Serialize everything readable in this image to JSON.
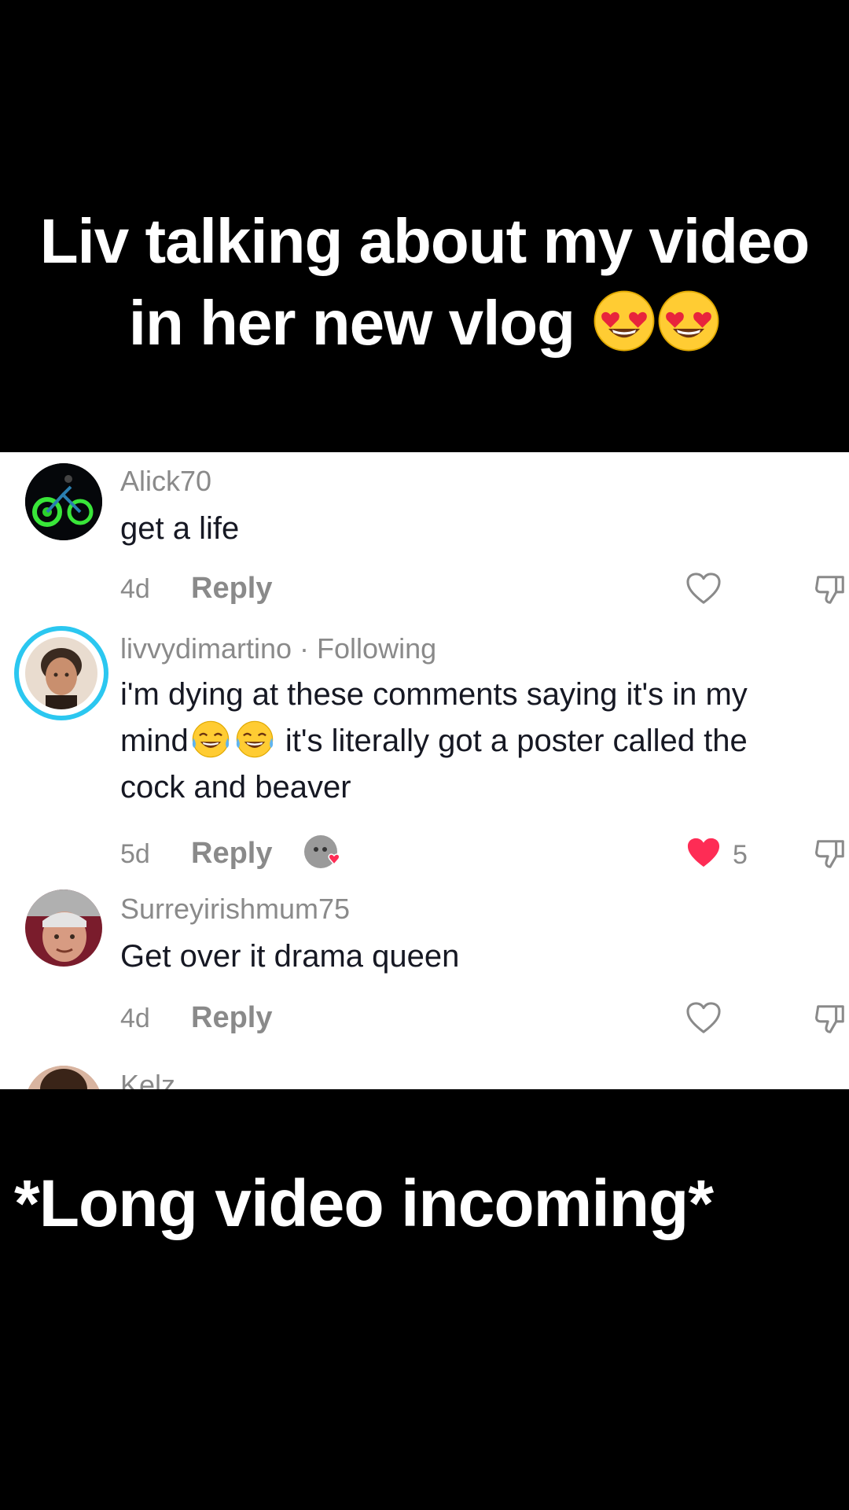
{
  "captions": {
    "top_line1": "Liv talking about my video",
    "top_line2": "in her new vlog",
    "bottom": "*Long video incoming*"
  },
  "comments": [
    {
      "username": "Alick70",
      "text": "get a life",
      "age": "4d",
      "reply_label": "Reply"
    },
    {
      "username": "livvydimartino · Following",
      "text_part1": "i'm dying at these comments saying it's in my mind",
      "text_part2": " it's literally got a poster called the cock and beaver",
      "age": "5d",
      "reply_label": "Reply",
      "like_count": "5"
    },
    {
      "username": "Surreyirishmum75",
      "text": "Get over it drama queen",
      "age": "4d",
      "reply_label": "Reply"
    },
    {
      "username": "Kelz"
    }
  ],
  "icons": {
    "emoji_caption": "heart-eyes-emoji",
    "emoji_comment": "tears-of-joy-emoji",
    "like": "heart-outline-icon",
    "liked": "heart-filled-icon",
    "dislike": "thumbs-down-icon"
  },
  "colors": {
    "liked_heart": "#fe2c55",
    "story_ring": "#2bc7f0",
    "muted_text": "#8a8a8a"
  }
}
